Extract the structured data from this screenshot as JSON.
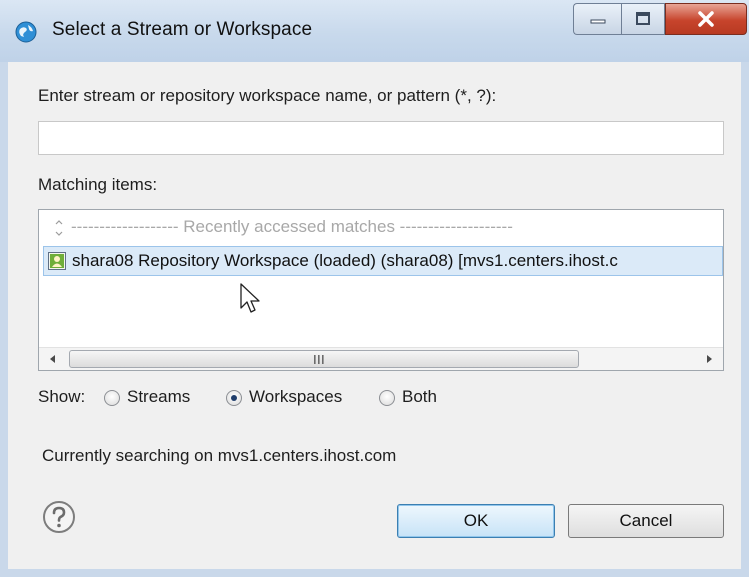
{
  "window": {
    "title": "Select a Stream or Workspace",
    "controls": {
      "minimize_icon": "minimize-icon",
      "maximize_icon": "maximize-icon",
      "close_icon": "close-icon"
    }
  },
  "search": {
    "label": "Enter stream or repository workspace name, or pattern (*, ?):",
    "value": "",
    "placeholder": ""
  },
  "matching": {
    "label": "Matching items:",
    "separator_text": "------------------- Recently accessed matches --------------------",
    "items": [
      {
        "label": "shara08 Repository Workspace (loaded) (shara08) [mvs1.centers.ihost.c",
        "icon": "repository-workspace-icon",
        "selected": true
      }
    ],
    "scrollbar_grip": "III"
  },
  "show": {
    "label": "Show:",
    "options": [
      {
        "label": "Streams",
        "checked": false
      },
      {
        "label": "Workspaces",
        "checked": true
      },
      {
        "label": "Both",
        "checked": false
      }
    ]
  },
  "status": "Currently searching on mvs1.centers.ihost.com",
  "buttons": {
    "ok": "OK",
    "cancel": "Cancel"
  },
  "colors": {
    "title_bar": "#c8d9ec",
    "dialog_bg": "#f0f0f0",
    "selection_bg": "#dbeaf8",
    "selection_border": "#9cc4ea",
    "close_button": "#c7442c",
    "default_button_border": "#3c7fb1"
  }
}
